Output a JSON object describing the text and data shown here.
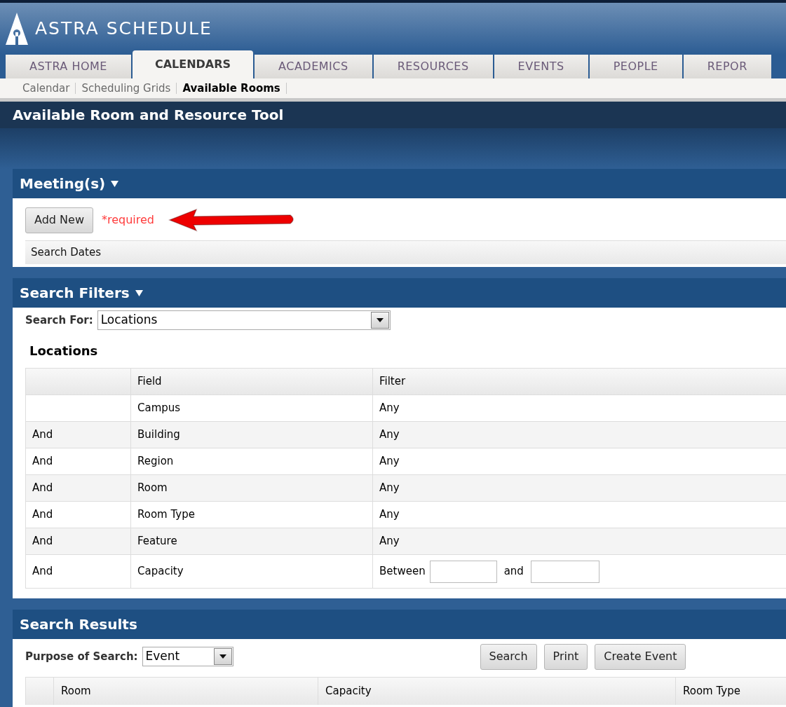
{
  "app": {
    "title": "ASTRA SCHEDULE"
  },
  "tabs": [
    {
      "label": "ASTRA HOME",
      "selected": false
    },
    {
      "label": "CALENDARS",
      "selected": true
    },
    {
      "label": "ACADEMICS",
      "selected": false
    },
    {
      "label": "RESOURCES",
      "selected": false
    },
    {
      "label": "EVENTS",
      "selected": false
    },
    {
      "label": "PEOPLE",
      "selected": false
    },
    {
      "label": "REPOR",
      "selected": false
    }
  ],
  "subnav": [
    {
      "label": "Calendar",
      "selected": false
    },
    {
      "label": "Scheduling Grids",
      "selected": false
    },
    {
      "label": "Available Rooms",
      "selected": true
    }
  ],
  "page_title": "Available Room and Resource Tool",
  "meetings": {
    "title": "Meeting(s)",
    "add_button": "Add New",
    "required_note": "*required",
    "search_dates": "Search Dates"
  },
  "filters": {
    "title": "Search Filters",
    "search_for_label": "Search For:",
    "search_for_value": "Locations",
    "table_title": "Locations",
    "columns": [
      "Field",
      "Filter"
    ],
    "rows": [
      {
        "conjunction": "",
        "field": "Campus",
        "kind": "text",
        "filter": "Any"
      },
      {
        "conjunction": "And",
        "field": "Building",
        "kind": "text",
        "filter": "Any"
      },
      {
        "conjunction": "And",
        "field": "Region",
        "kind": "text",
        "filter": "Any"
      },
      {
        "conjunction": "And",
        "field": "Room",
        "kind": "text",
        "filter": "Any"
      },
      {
        "conjunction": "And",
        "field": "Room Type",
        "kind": "text",
        "filter": "Any"
      },
      {
        "conjunction": "And",
        "field": "Feature",
        "kind": "text",
        "filter": "Any"
      },
      {
        "conjunction": "And",
        "field": "Capacity",
        "kind": "range",
        "from_label": "Between",
        "to_label": "and"
      }
    ]
  },
  "results": {
    "title": "Search Results",
    "purpose_label": "Purpose of Search:",
    "purpose_value": "Event",
    "buttons": [
      "Search",
      "Print",
      "Create Event"
    ],
    "columns": [
      "Room",
      "Capacity",
      "Room Type"
    ]
  }
}
